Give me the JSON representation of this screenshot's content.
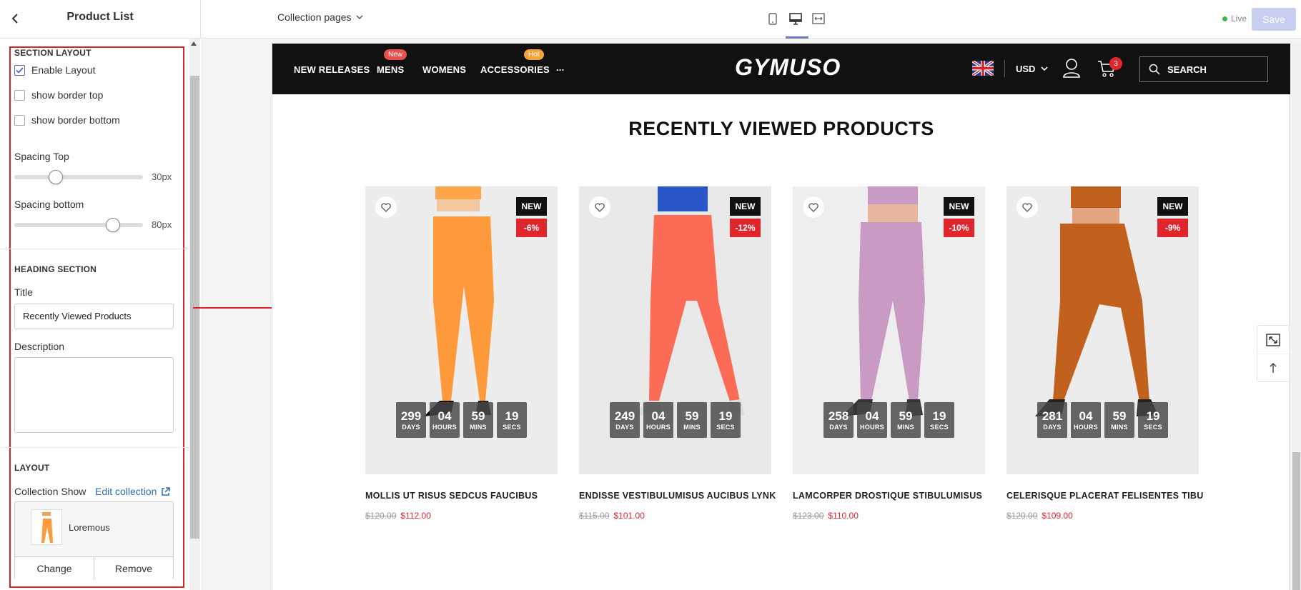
{
  "header": {
    "back_icon": "chevron-left-icon",
    "title": "Product List",
    "template_dropdown": "Collection pages",
    "devices": [
      "mobile-icon",
      "desktop-icon",
      "fullwidth-icon"
    ],
    "status": "Live",
    "save_label": "Save"
  },
  "sidebar": {
    "section_layout": {
      "heading": "SECTION LAYOUT",
      "enable_layout": {
        "label": "Enable Layout",
        "checked": true
      },
      "border_top": {
        "label": "show border top",
        "checked": false
      },
      "border_bottom": {
        "label": "show border bottom",
        "checked": false
      },
      "spacing_top": {
        "label": "Spacing Top",
        "value": 30,
        "display": "30px"
      },
      "spacing_bottom": {
        "label": "Spacing bottom",
        "value": 80,
        "display": "80px"
      }
    },
    "heading_section": {
      "heading": "HEADING SECTION",
      "title_label": "Title",
      "title_value": "Recently Viewed Products",
      "description_label": "Description",
      "description_value": ""
    },
    "layout": {
      "heading": "LAYOUT",
      "collection_label": "Collection Show",
      "edit_link": "Edit collection",
      "collection_name": "Loremous",
      "change_label": "Change",
      "remove_label": "Remove"
    }
  },
  "store": {
    "nav": [
      {
        "label": "NEW RELEASES",
        "badge": ""
      },
      {
        "label": "MENS",
        "badge": "New"
      },
      {
        "label": "WOMENS",
        "badge": ""
      },
      {
        "label": "ACCESSORIES",
        "badge": "Hot"
      },
      {
        "label": "...",
        "badge": ""
      }
    ],
    "badge_colors": {
      "New": "#e8504f",
      "Hot": "#f3a33b"
    },
    "logo": "GYMUSO",
    "currency": "USD",
    "cart_count": "3",
    "search_label": "SEARCH",
    "section_title": "RECENTLY VIEWED PRODUCTS",
    "products": [
      {
        "title": "MOLLIS UT RISUS SEDCUS FAUCIBUS",
        "old_price": "$120.00",
        "price": "$112.00",
        "badge_new": "NEW",
        "badge_off": "-6%",
        "countdown": [
          "299",
          "04",
          "59",
          "19"
        ],
        "legging_color": "#ff9a3c"
      },
      {
        "title": "ENDISSE VESTIBULUMISUS AUCIBUS LYNK",
        "old_price": "$115.00",
        "price": "$101.00",
        "badge_new": "NEW",
        "badge_off": "-12%",
        "countdown": [
          "249",
          "04",
          "59",
          "19"
        ],
        "legging_color": "#fb6b55"
      },
      {
        "title": "LAMCORPER DROSTIQUE STIBULUMISUS",
        "old_price": "$123.00",
        "price": "$110.00",
        "badge_new": "NEW",
        "badge_off": "-10%",
        "countdown": [
          "258",
          "04",
          "59",
          "19"
        ],
        "legging_color": "#c99ac4"
      },
      {
        "title": "CELERISQUE PLACERAT FELISENTES TIBU",
        "old_price": "$120.00",
        "price": "$109.00",
        "badge_new": "NEW",
        "badge_off": "-9%",
        "countdown": [
          "281",
          "04",
          "59",
          "19"
        ],
        "legging_color": "#c2611e"
      }
    ],
    "countdown_labels": [
      "DAYS",
      "HOURS",
      "MINS",
      "SECS"
    ]
  },
  "colors": {
    "accent": "#d9232d",
    "sale": "#e0262d",
    "link": "#2a6cb3"
  }
}
